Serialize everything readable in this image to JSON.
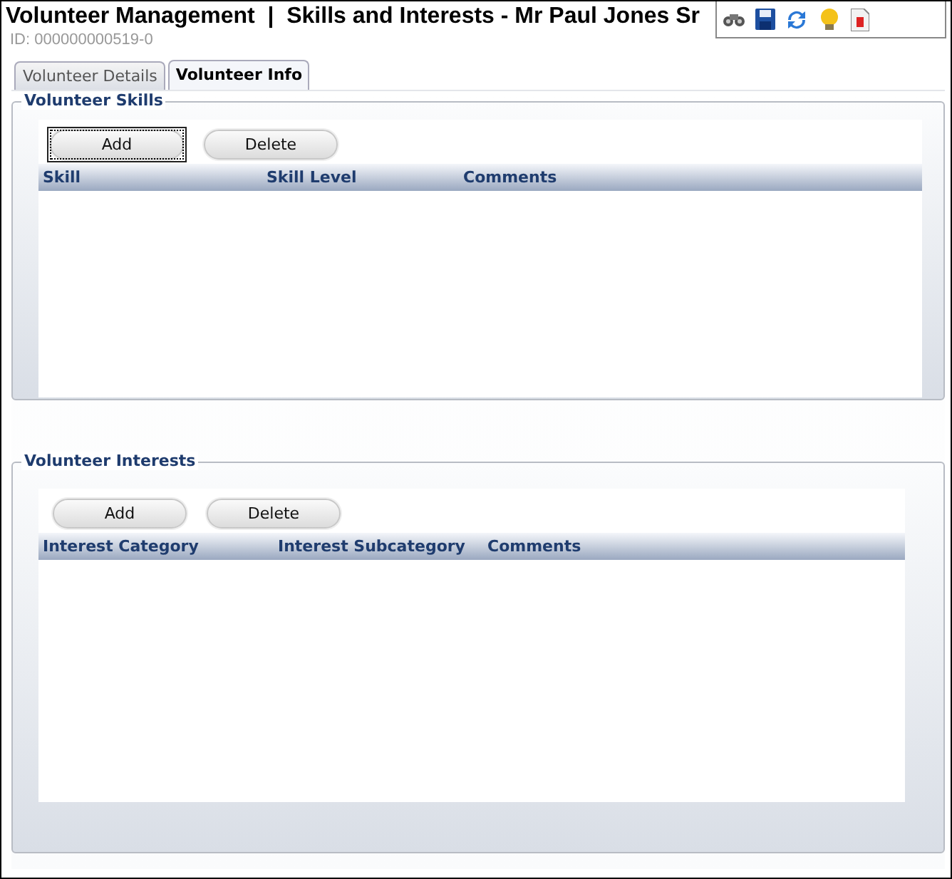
{
  "header": {
    "title": "Volunteer Management  |  Skills and Interests - Mr Paul Jones Sr",
    "id": "ID: 000000000519-0"
  },
  "tabs": [
    {
      "label": "Volunteer Details",
      "selected": false
    },
    {
      "label": "Volunteer Info",
      "selected": true
    }
  ],
  "sections": [
    {
      "title": "Volunteer Skills",
      "buttons": [
        {
          "label": "Add",
          "focused": true
        },
        {
          "label": "Delete",
          "focused": false
        }
      ],
      "columns": [
        {
          "label": "Skill"
        },
        {
          "label": "Skill Level"
        },
        {
          "label": "Comments"
        }
      ]
    },
    {
      "title": "Volunteer Interests",
      "buttons": [
        {
          "label": "Add",
          "focused": false
        },
        {
          "label": "Delete",
          "focused": false
        }
      ],
      "columns": [
        {
          "label": "Interest Category"
        },
        {
          "label": "Interest Subcategory"
        },
        {
          "label": "Comments"
        }
      ]
    }
  ]
}
